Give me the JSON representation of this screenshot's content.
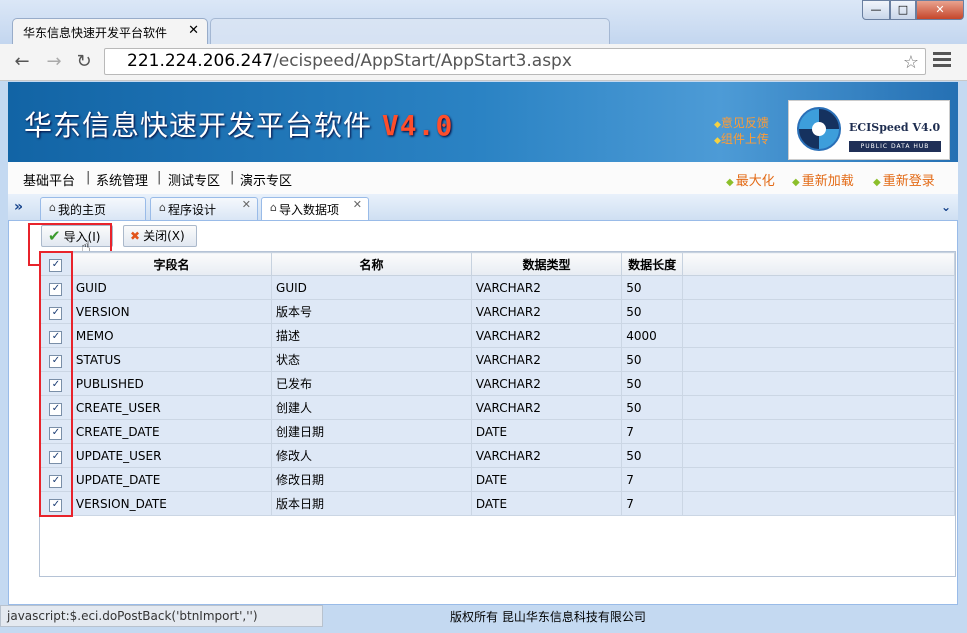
{
  "browser": {
    "tab_title": "华东信息快速开发平台软件",
    "tab_close": "✕",
    "url_host": "221.224.206.247",
    "url_path": "/ecispeed/AppStart/AppStart3.aspx",
    "back_icon": "back-arrow-icon",
    "forward_icon": "forward-arrow-icon",
    "reload_icon": "reload-icon"
  },
  "window_controls": {
    "minimize": "—",
    "maximize": "□",
    "close": "✕"
  },
  "header": {
    "title": "华东信息快速开发平台软件",
    "version": "V4.0",
    "feedback": "意见反馈",
    "upload": "组件上传",
    "logo_name": "ECISpeed V4.0",
    "logo_sub": "PUBLIC DATA HUB"
  },
  "menu": {
    "items": [
      "基础平台",
      "系统管理",
      "测试专区",
      "演示专区"
    ],
    "right_links": [
      "最大化",
      "重新加载",
      "重新登录"
    ]
  },
  "content_tabs": [
    {
      "label": "我的主页"
    },
    {
      "label": "程序设计"
    },
    {
      "label": "导入数据项"
    }
  ],
  "toolbar": {
    "import_label": "导入(I)",
    "close_label": "关闭(X)"
  },
  "grid": {
    "columns": [
      "字段名",
      "名称",
      "数据类型",
      "数据长度"
    ],
    "rows": [
      [
        "GUID",
        "GUID",
        "VARCHAR2",
        "50"
      ],
      [
        "VERSION",
        "版本号",
        "VARCHAR2",
        "50"
      ],
      [
        "MEMO",
        "描述",
        "VARCHAR2",
        "4000"
      ],
      [
        "STATUS",
        "状态",
        "VARCHAR2",
        "50"
      ],
      [
        "PUBLISHED",
        "已发布",
        "VARCHAR2",
        "50"
      ],
      [
        "CREATE_USER",
        "创建人",
        "VARCHAR2",
        "50"
      ],
      [
        "CREATE_DATE",
        "创建日期",
        "DATE",
        "7"
      ],
      [
        "UPDATE_USER",
        "修改人",
        "VARCHAR2",
        "50"
      ],
      [
        "UPDATE_DATE",
        "修改日期",
        "DATE",
        "7"
      ],
      [
        "VERSION_DATE",
        "版本日期",
        "DATE",
        "7"
      ]
    ],
    "all_checked": true
  },
  "status_text": "javascript:$.eci.doPostBack('btnImport','')",
  "footer": "版权所有 昆山华东信息科技有限公司",
  "colors": {
    "accent": "#1264a5",
    "highlight": "#e8232b",
    "link_orange": "#e36b17"
  }
}
